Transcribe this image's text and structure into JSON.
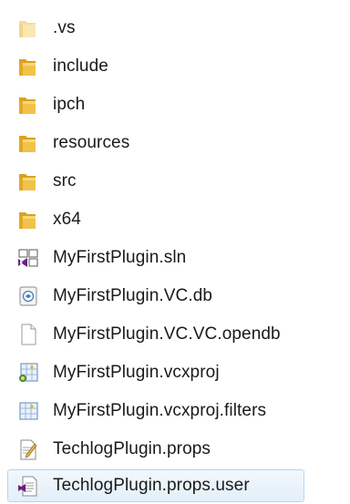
{
  "files": [
    {
      "name": ".vs",
      "icon": "folder-faded-icon",
      "selected": false
    },
    {
      "name": "include",
      "icon": "folder-icon",
      "selected": false
    },
    {
      "name": "ipch",
      "icon": "folder-icon",
      "selected": false
    },
    {
      "name": "resources",
      "icon": "folder-icon",
      "selected": false
    },
    {
      "name": "src",
      "icon": "folder-icon",
      "selected": false
    },
    {
      "name": "x64",
      "icon": "folder-icon",
      "selected": false
    },
    {
      "name": "MyFirstPlugin.sln",
      "icon": "visual-studio-solution-icon",
      "selected": false
    },
    {
      "name": "MyFirstPlugin.VC.db",
      "icon": "database-file-icon",
      "selected": false
    },
    {
      "name": "MyFirstPlugin.VC.VC.opendb",
      "icon": "blank-file-icon",
      "selected": false
    },
    {
      "name": "MyFirstPlugin.vcxproj",
      "icon": "vcxproj-file-icon",
      "selected": false
    },
    {
      "name": "MyFirstPlugin.vcxproj.filters",
      "icon": "vcxproj-filters-file-icon",
      "selected": false
    },
    {
      "name": "TechlogPlugin.props",
      "icon": "props-file-icon",
      "selected": false
    },
    {
      "name": "TechlogPlugin.props.user",
      "icon": "props-user-file-icon",
      "selected": true
    }
  ],
  "colors": {
    "folder": "#e8b22e",
    "folder_light": "#f7dc8a",
    "selection_bg": "#e3eff9",
    "selection_border": "#b7d6f0",
    "vs_purple": "#68217a"
  }
}
